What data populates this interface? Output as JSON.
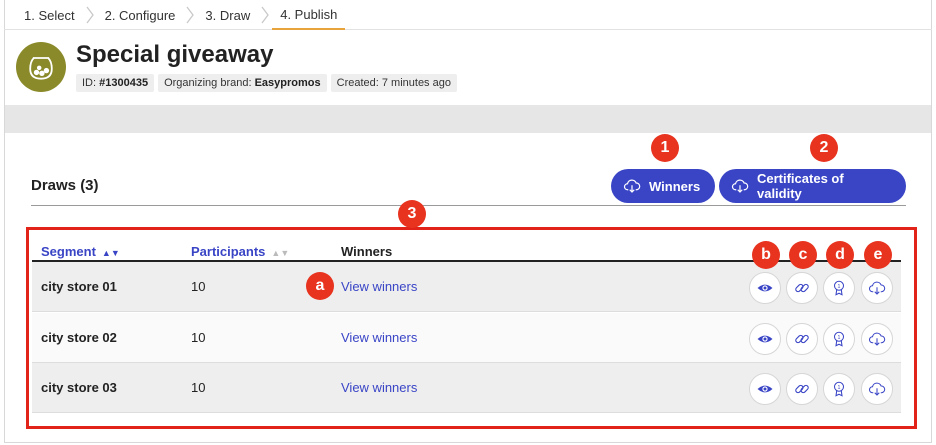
{
  "stepper": {
    "steps": [
      {
        "label": "1. Select"
      },
      {
        "label": "2. Configure"
      },
      {
        "label": "3. Draw"
      },
      {
        "label": "4. Publish"
      }
    ]
  },
  "header": {
    "title": "Special giveaway",
    "id_label": "ID:",
    "id_value": "#1300435",
    "brand_label": "Organizing brand:",
    "brand_value": "Easypromos",
    "created": "Created: 7 minutes ago"
  },
  "draws": {
    "title": "Draws (3)",
    "winners_button": "Winners",
    "certificates_button": "Certificates of validity"
  },
  "markers": {
    "m1": "1",
    "m2": "2",
    "m3": "3",
    "a": "a",
    "b": "b",
    "c": "c",
    "d": "d",
    "e": "e"
  },
  "table": {
    "headers": {
      "segment": "Segment",
      "participants": "Participants",
      "winners": "Winners"
    },
    "rows": [
      {
        "segment": "city store 01",
        "participants": "10",
        "winners_link": "View winners"
      },
      {
        "segment": "city store 02",
        "participants": "10",
        "winners_link": "View winners"
      },
      {
        "segment": "city store 03",
        "participants": "10",
        "winners_link": "View winners"
      }
    ]
  },
  "icons": {
    "row_actions": [
      "eye-icon",
      "link-icon",
      "certificate-icon",
      "cloud-download-icon"
    ],
    "button_icon": "cloud-download-icon"
  },
  "colors": {
    "primary": "#3a45c6",
    "marker": "#e8331f",
    "step_active": "#e8a33a",
    "logo": "#8a8a2a"
  }
}
